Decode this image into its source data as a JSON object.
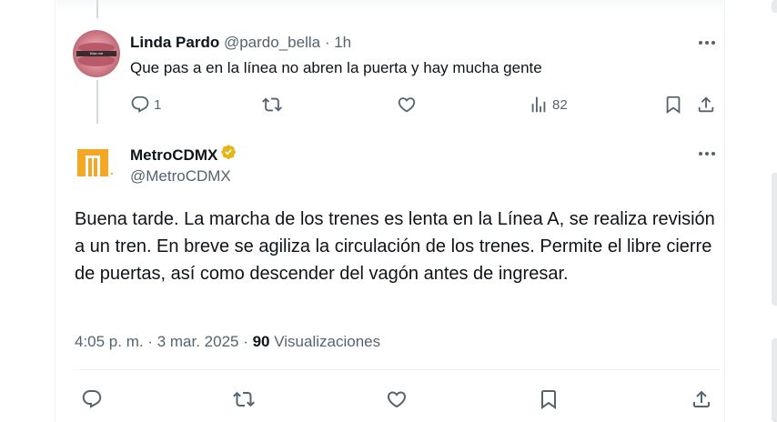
{
  "reply": {
    "name": "Linda Pardo",
    "handle": "@pardo_bella",
    "separator": "·",
    "time": "1h",
    "text": "Que pas a en la línea no  abren la puerta y hay mucha gente",
    "reply_count": "1",
    "views_count": "82",
    "avatar_text": "Kiss me"
  },
  "tweet": {
    "name": "MetroCDMX",
    "handle": "@MetroCDMX",
    "text": "Buena tarde. La marcha de los trenes es lenta en la Línea A, se realiza revisión a un tren. En breve se agiliza la circulación de los trenes. Permite el libre cierre de puertas, así como descender del vagón antes de ingresar.",
    "timestamp": "4:05 p. m. · 3 mar. 2025 · ",
    "views_count": "90",
    "views_label": " Visualizaciones"
  },
  "icons": {
    "reply": "reply-icon",
    "repost": "repost-icon",
    "like": "heart-icon",
    "views": "analytics-icon",
    "bookmark": "bookmark-icon",
    "share": "share-icon",
    "more": "more-icon",
    "verified": "verified-badge-icon"
  },
  "colors": {
    "metro_orange": "#F5A623",
    "verified_gold": "#E2B719",
    "muted": "#536471"
  }
}
